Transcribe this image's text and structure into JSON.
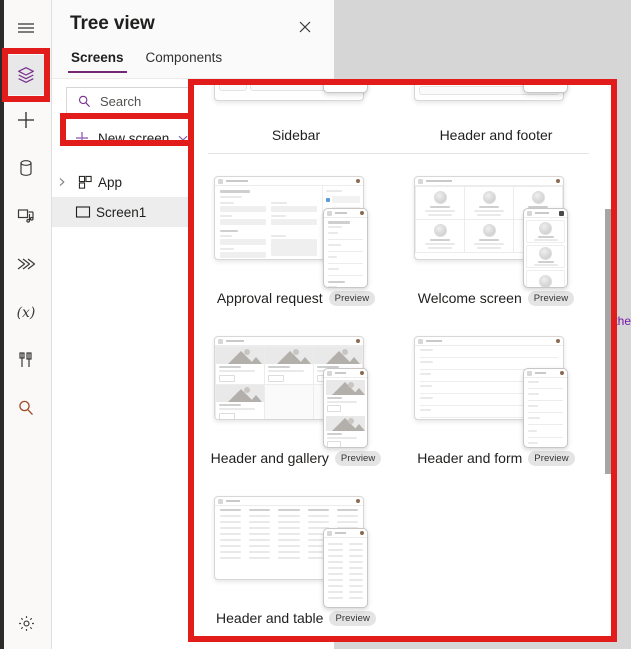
{
  "app": {
    "rail_icons": [
      {
        "name": "hamburger-menu-icon",
        "label": "Menu"
      },
      {
        "name": "tree-view-icon",
        "label": "Tree view"
      },
      {
        "name": "plus-insert-icon",
        "label": "Insert"
      },
      {
        "name": "database-data-icon",
        "label": "Data"
      },
      {
        "name": "media-icon",
        "label": "Media"
      },
      {
        "name": "power-automate-icon",
        "label": "Power Automate"
      },
      {
        "name": "variables-icon",
        "label": "Variables"
      },
      {
        "name": "tools-icon",
        "label": "App checker"
      },
      {
        "name": "search-icon",
        "label": "Search"
      },
      {
        "name": "settings-gear-icon",
        "label": "Settings"
      }
    ]
  },
  "panel": {
    "title": "Tree view",
    "close_label": "✕",
    "tabs": [
      {
        "label": "Screens",
        "active": true
      },
      {
        "label": "Components",
        "active": false
      }
    ],
    "search": {
      "placeholder": "Search",
      "value": ""
    },
    "new_screen": {
      "label": "New screen",
      "plus": "+",
      "chevron": "⌄"
    },
    "tree": [
      {
        "label": "App",
        "expanded": false,
        "selected": false
      },
      {
        "label": "Screen1",
        "expanded": false,
        "selected": true
      }
    ]
  },
  "gallery": {
    "templates": [
      {
        "label": "Sidebar",
        "badge": "",
        "row": 0
      },
      {
        "label": "Header and footer",
        "badge": "",
        "row": 0
      },
      {
        "label": "Approval request",
        "badge": "Preview",
        "row": 1
      },
      {
        "label": "Welcome screen",
        "badge": "Preview",
        "row": 1
      },
      {
        "label": "Header and gallery",
        "badge": "Preview",
        "row": 2
      },
      {
        "label": "Header and form",
        "badge": "Preview",
        "row": 2
      },
      {
        "label": "Header and table",
        "badge": "Preview",
        "row": 3
      }
    ],
    "clipped_link_text": "the"
  },
  "annotations": [
    {
      "name": "tree-view-rail-icon-highlight",
      "color": "#e21b1b"
    },
    {
      "name": "new-screen-button-highlight",
      "color": "#e21b1b"
    },
    {
      "name": "screen-template-gallery-highlight",
      "color": "#e21b1b"
    }
  ],
  "colors": {
    "annotation_red": "#e21b1b",
    "accent_purple": "#742774",
    "selected_row": "#ededed",
    "panel_bg": "#fafafa",
    "canvas_bg": "#d6d6d6"
  }
}
